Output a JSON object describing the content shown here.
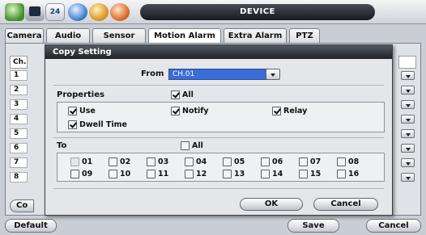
{
  "window": {
    "title": "DEVICE",
    "date_icon_text": "24"
  },
  "toolbar_icons": [
    "camera-icon",
    "monitor-icon",
    "date-icon",
    "network-icon",
    "device-icon",
    "utility-icon"
  ],
  "tabs": [
    {
      "label": "Camera",
      "active": false
    },
    {
      "label": "Audio",
      "active": false
    },
    {
      "label": "Sensor",
      "active": false
    },
    {
      "label": "Motion Alarm",
      "active": true
    },
    {
      "label": "Extra Alarm",
      "active": false
    },
    {
      "label": "PTZ",
      "active": false
    }
  ],
  "background": {
    "channel_header": "Ch.",
    "channel_rows": [
      "1",
      "2",
      "3",
      "4",
      "5",
      "6",
      "7",
      "8"
    ],
    "copy_button_label": "Co"
  },
  "footer": {
    "default_label": "Default",
    "save_label": "Save",
    "cancel_label": "Cancel"
  },
  "dialog": {
    "title": "Copy Setting",
    "from_label": "From",
    "from_value": "CH.01",
    "properties_label": "Properties",
    "properties_all_label": "All",
    "properties_all_checked": true,
    "properties": [
      {
        "label": "Use",
        "checked": true
      },
      {
        "label": "Notify",
        "checked": true
      },
      {
        "label": "Relay",
        "checked": true
      },
      {
        "label": "Dwell Time",
        "checked": true
      }
    ],
    "to_label": "To",
    "to_all_label": "All",
    "to_all_checked": false,
    "channels": [
      {
        "label": "01",
        "checked": false,
        "disabled": true
      },
      {
        "label": "02",
        "checked": false,
        "disabled": false
      },
      {
        "label": "03",
        "checked": false,
        "disabled": false
      },
      {
        "label": "04",
        "checked": false,
        "disabled": false
      },
      {
        "label": "05",
        "checked": false,
        "disabled": false
      },
      {
        "label": "06",
        "checked": false,
        "disabled": false
      },
      {
        "label": "07",
        "checked": false,
        "disabled": false
      },
      {
        "label": "08",
        "checked": false,
        "disabled": false
      },
      {
        "label": "09",
        "checked": false,
        "disabled": false
      },
      {
        "label": "10",
        "checked": false,
        "disabled": false
      },
      {
        "label": "11",
        "checked": false,
        "disabled": false
      },
      {
        "label": "12",
        "checked": false,
        "disabled": false
      },
      {
        "label": "13",
        "checked": false,
        "disabled": false
      },
      {
        "label": "14",
        "checked": false,
        "disabled": false
      },
      {
        "label": "15",
        "checked": false,
        "disabled": false
      },
      {
        "label": "16",
        "checked": false,
        "disabled": false
      }
    ],
    "ok_label": "OK",
    "cancel_label": "Cancel"
  }
}
